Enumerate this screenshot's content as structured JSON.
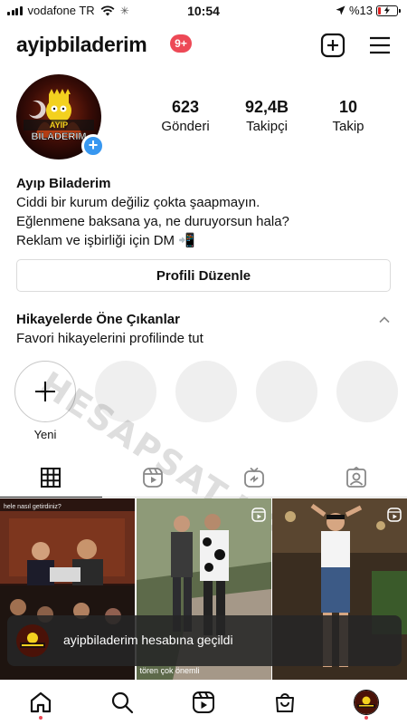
{
  "status_bar": {
    "carrier": "vodafone TR",
    "time": "10:54",
    "battery": "%13"
  },
  "header": {
    "username": "ayipbiladerim",
    "notification_count": "9+",
    "icons": [
      "plus-square-icon",
      "menu-icon"
    ]
  },
  "profile": {
    "avatar_text": "AYIP BILADERIM",
    "stats": [
      {
        "value": "623",
        "label": "Gönderi"
      },
      {
        "value": "92,4B",
        "label": "Takipçi"
      },
      {
        "value": "10",
        "label": "Takip"
      }
    ],
    "display_name": "Ayıp Biladerim",
    "bio_lines": [
      "Ciddi bir kurum değiliz çokta şaapmayın.",
      "Eğlenmene baksana ya, ne duruyorsun hala?",
      "Reklam ve işbirliği için DM 📲"
    ],
    "edit_button": "Profili Düzenle"
  },
  "highlights": {
    "title": "Hikayelerde Öne Çıkanlar",
    "subtitle": "Favori hikayelerini profilinde tut",
    "new_label": "Yeni"
  },
  "watermark": "HESAPSAT.NET",
  "tabs": [
    "grid-icon",
    "reels-icon",
    "igtv-icon",
    "tagged-icon"
  ],
  "posts": [
    {
      "caption": "hele nasıl getirdiniz?",
      "bottom_text": ""
    },
    {
      "caption": "",
      "bottom_text": "tören çok önemli"
    },
    {
      "caption": "",
      "bottom_text": ""
    }
  ],
  "toast": {
    "message": "ayipbiladerim hesabına geçildi"
  },
  "bottom_nav": [
    "home-icon",
    "search-icon",
    "reels-icon",
    "shop-icon",
    "profile-avatar"
  ],
  "colors": {
    "accent_blue": "#3897f0",
    "badge_red": "#ed4956",
    "border": "#dbdbdb"
  }
}
